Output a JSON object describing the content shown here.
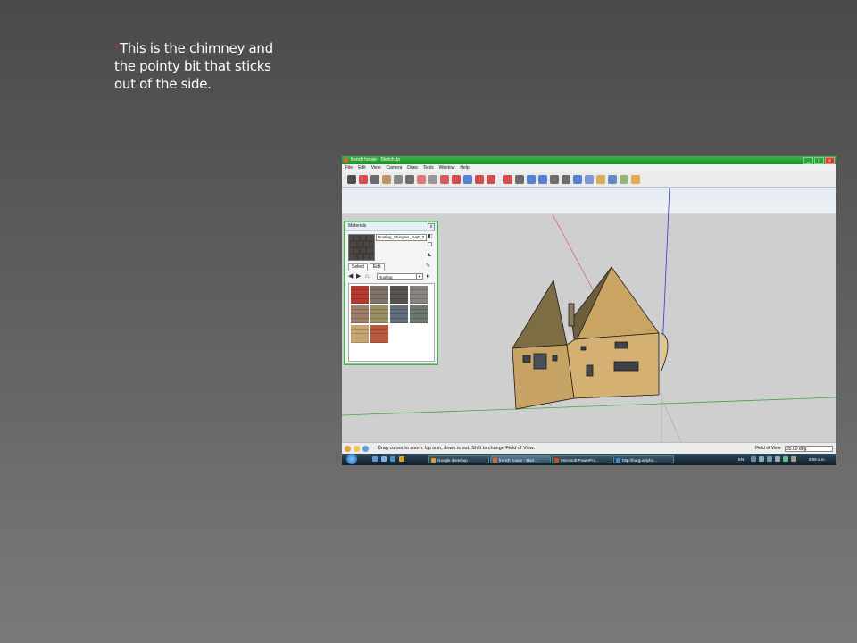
{
  "slide": {
    "text_line1": "This is the chimney and",
    "text_line2": "the pointy bit that sticks",
    "text_line3": "out of the side.",
    "bullet_color": "#d81e3c"
  },
  "window": {
    "title": "french house - SketchUp",
    "controls": [
      "_",
      "□",
      "x"
    ]
  },
  "menu": [
    "File",
    "Edit",
    "View",
    "Camera",
    "Draw",
    "Tools",
    "Window",
    "Help"
  ],
  "toolbar_icons": [
    "select-tool-icon",
    "pencil-icon",
    "line-icon",
    "rectangle-icon",
    "circle-icon",
    "arc-icon",
    "eraser-icon",
    "tape-measure-icon",
    "paint-bucket-icon",
    "push-pull-icon",
    "rotate-icon",
    "move-icon",
    "offset-icon",
    "follow-me-icon",
    "scale-icon",
    "orbit-icon",
    "pan-icon",
    "zoom-icon",
    "zoom-extents-icon",
    "component-icon",
    "iso-view-icon",
    "top-view-icon",
    "front-view-icon",
    "warehouse-icon",
    "layers-icon"
  ],
  "materials": {
    "title": "Materials",
    "close": "x",
    "current_name": "Roofing_Shingles_GAF_3",
    "tabs": [
      "Select",
      "Edit"
    ],
    "library": "Roofing",
    "swatch_colors": [
      "#b83a2e",
      "#7e7468",
      "#595350",
      "#8a8480",
      "#9c7f6a",
      "#9a9066",
      "#61707a",
      "#6e7870",
      "#c8a672",
      "#b85a3c"
    ]
  },
  "statusbar": {
    "message": "Drag cursor to zoom.  Up is in, down is out. Shift to change Field of View.",
    "fov_label": "Field of View",
    "fov_value": "35.00 deg."
  },
  "taskbar": {
    "items": [
      "Google sketchup",
      "french house - Sket...",
      "Microsoft PowerPoi...",
      "http://burgundyho..."
    ],
    "language": "EN",
    "clock": "9:08 a.m."
  }
}
